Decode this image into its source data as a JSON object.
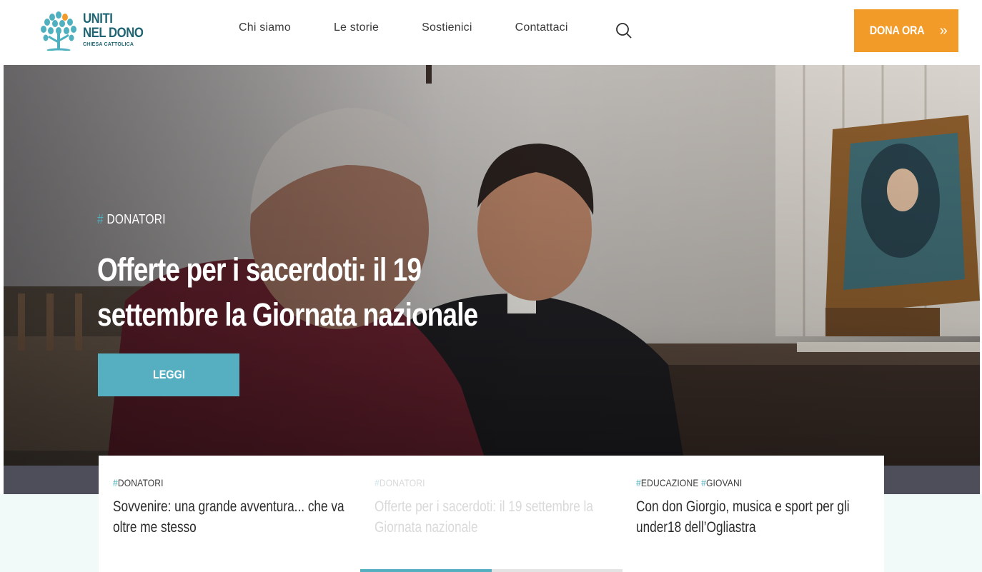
{
  "brand": {
    "line1": "UNITI",
    "line2": "NEL DONO",
    "sub": "CHIESA CATTOLICA",
    "primary_color": "#1e6473",
    "accent_color": "#4fb0c0",
    "orange": "#f39b28"
  },
  "nav": {
    "items": [
      {
        "label": "Chi siamo"
      },
      {
        "label": "Le storie"
      },
      {
        "label": "Sostienici"
      },
      {
        "label": "Contattaci"
      }
    ],
    "search_icon": "search-icon"
  },
  "donate": {
    "label": "DONA ORA",
    "arrow": "»"
  },
  "hero": {
    "hash": "#",
    "tag": "DONATORI",
    "title": "Offerte per i sacerdoti: il 19 settembre la Giornata nazionale",
    "button": "LEGGI"
  },
  "cards": [
    {
      "tags": [
        {
          "hash": "#",
          "label": "DONATORI"
        }
      ],
      "title": "Sovvenire: una grande avventura... che va oltre me stesso"
    },
    {
      "tags": [
        {
          "hash": "#",
          "label": "DONATORI"
        }
      ],
      "title": "Offerte per i sacerdoti: il 19 settembre la Giornata nazionale"
    },
    {
      "tags": [
        {
          "hash": "#",
          "label": "EDUCAZIONE "
        },
        {
          "hash": "#",
          "label": "GIOVANI"
        }
      ],
      "title": "Con don Giorgio, musica e sport per gli under18 dell’Ogliastra"
    }
  ],
  "carousel": {
    "progress": 0.5
  }
}
